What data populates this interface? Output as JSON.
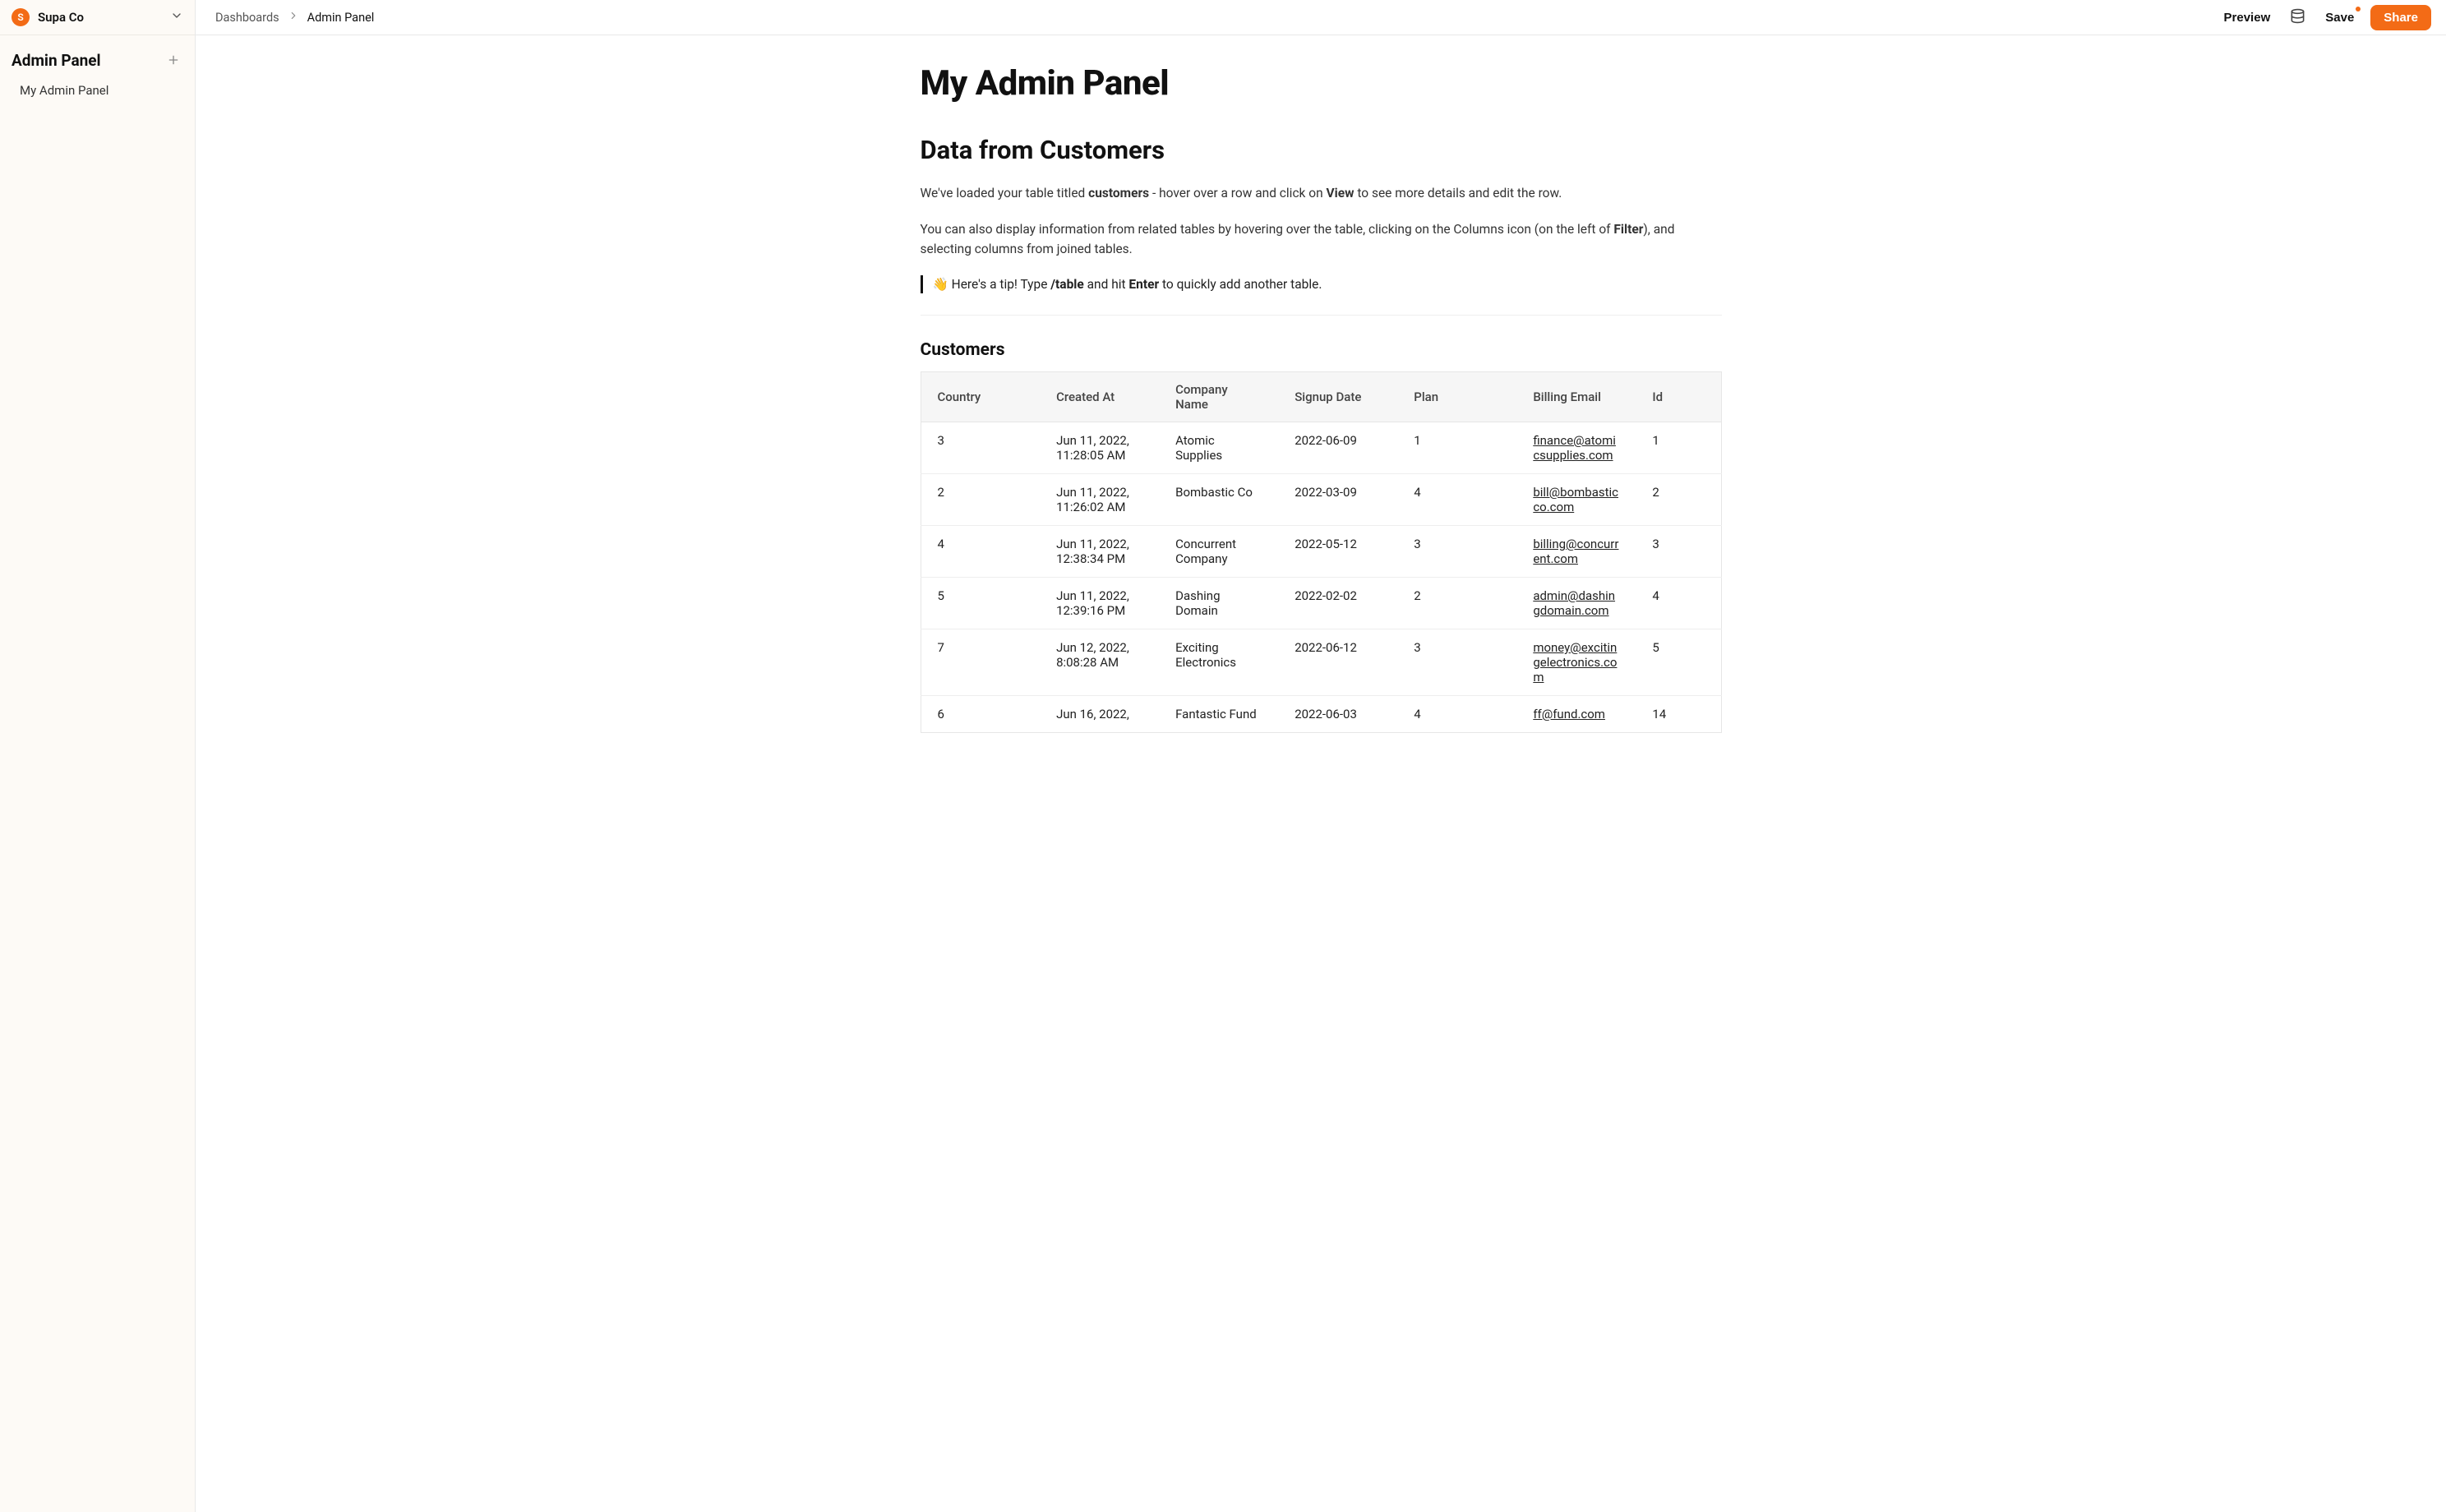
{
  "workspace": {
    "initial": "S",
    "name": "Supa Co"
  },
  "sidebar": {
    "section_title": "Admin Panel",
    "items": [
      {
        "label": "My Admin Panel"
      }
    ]
  },
  "breadcrumb": {
    "root": "Dashboards",
    "current": "Admin Panel"
  },
  "topbar": {
    "preview": "Preview",
    "save": "Save",
    "share": "Share"
  },
  "page": {
    "title": "My Admin Panel",
    "section_title": "Data from Customers",
    "intro_parts": {
      "p1_a": "We've loaded your table titled ",
      "p1_b": "customers",
      "p1_c": " - hover over a row and click on ",
      "p1_d": "View",
      "p1_e": " to see more details and edit the row.",
      "p2_a": "You can also display information from related tables by hovering over the table, clicking on the Columns icon (on the left of ",
      "p2_b": "Filter",
      "p2_c": "), and selecting columns from joined tables."
    },
    "tip": {
      "emoji": "👋",
      "a": " Here's a tip! Type ",
      "b": "/table",
      "c": " and hit ",
      "d": "Enter",
      "e": " to quickly add another table."
    },
    "table_title": "Customers"
  },
  "table": {
    "columns": [
      "Country",
      "Created At",
      "Company Name",
      "Signup Date",
      "Plan",
      "Billing Email",
      "Id"
    ],
    "rows": [
      {
        "country": "3",
        "created_at": "Jun 11, 2022, 11:28:05 AM",
        "company": "Atomic Supplies",
        "signup": "2022-06-09",
        "plan": "1",
        "email": "finance@atomicsupplies.com",
        "id": "1"
      },
      {
        "country": "2",
        "created_at": "Jun 11, 2022, 11:26:02 AM",
        "company": "Bombastic Co",
        "signup": "2022-03-09",
        "plan": "4",
        "email": "bill@bombasticco.com",
        "id": "2"
      },
      {
        "country": "4",
        "created_at": "Jun 11, 2022, 12:38:34 PM",
        "company": "Concurrent Company",
        "signup": "2022-05-12",
        "plan": "3",
        "email": "billing@concurrent.com",
        "id": "3"
      },
      {
        "country": "5",
        "created_at": "Jun 11, 2022, 12:39:16 PM",
        "company": "Dashing Domain",
        "signup": "2022-02-02",
        "plan": "2",
        "email": "admin@dashingdomain.com",
        "id": "4"
      },
      {
        "country": "7",
        "created_at": "Jun 12, 2022, 8:08:28 AM",
        "company": "Exciting Electronics",
        "signup": "2022-06-12",
        "plan": "3",
        "email": "money@excitingelectronics.com",
        "id": "5"
      },
      {
        "country": "6",
        "created_at": "Jun 16, 2022,",
        "company": "Fantastic Fund",
        "signup": "2022-06-03",
        "plan": "4",
        "email": "ff@fund.com",
        "id": "14"
      }
    ]
  }
}
